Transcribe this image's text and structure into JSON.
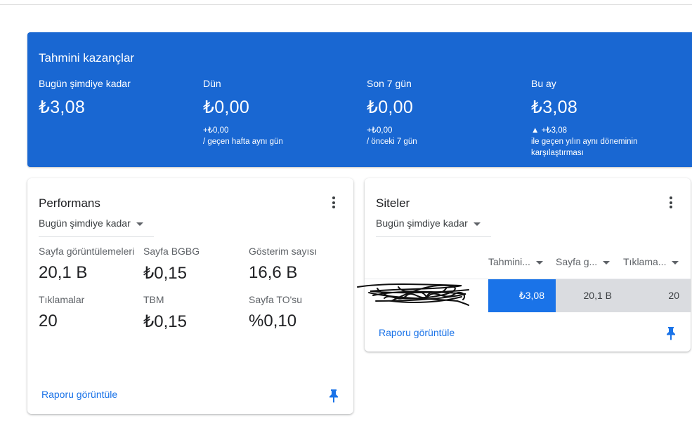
{
  "earnings": {
    "title": "Tahmini kazançlar",
    "today": {
      "label": "Bugün şimdiye kadar",
      "value": "₺3,08"
    },
    "yesterday": {
      "label": "Dün",
      "value": "₺0,00",
      "delta": "+₺0,00",
      "comparison": "/ geçen hafta aynı gün"
    },
    "last7": {
      "label": "Son 7 gün",
      "value": "₺0,00",
      "delta": "+₺0,00",
      "comparison": "/ önceki 7 gün"
    },
    "month": {
      "label": "Bu ay",
      "value": "₺3,08",
      "delta": "▲ +₺3,08",
      "comparison_line1": "ile geçen yılın aynı döneminin",
      "comparison_line2": "karşılaştırması"
    }
  },
  "performance": {
    "title": "Performans",
    "period": "Bugün şimdiye kadar",
    "metrics": [
      {
        "label": "Sayfa görüntülemeleri",
        "value": "20,1 B"
      },
      {
        "label": "Sayfa BGBG",
        "value": "₺0,15"
      },
      {
        "label": "Gösterim sayısı",
        "value": "16,6 B"
      },
      {
        "label": "Tıklamalar",
        "value": "20"
      },
      {
        "label": "TBM",
        "value": "₺0,15"
      },
      {
        "label": "Sayfa TO'su",
        "value": "%0,10"
      }
    ],
    "report_link": "Raporu görüntüle"
  },
  "sites": {
    "title": "Siteler",
    "period": "Bugün şimdiye kadar",
    "columns": [
      "Tahmini...",
      "Sayfa g...",
      "Tıklama..."
    ],
    "rows": [
      {
        "earnings": "₺3,08",
        "pageviews": "20,1 B",
        "clicks": "20"
      }
    ],
    "report_link": "Raporu görüntüle"
  },
  "colors": {
    "accent": "#1a73e8",
    "card_blue": "#1967d2",
    "pin": "#1a73e8"
  },
  "icons": {
    "menu": "more-vert-icon",
    "pin": "pin-icon",
    "dropdown": "arrow-drop-down-icon"
  }
}
